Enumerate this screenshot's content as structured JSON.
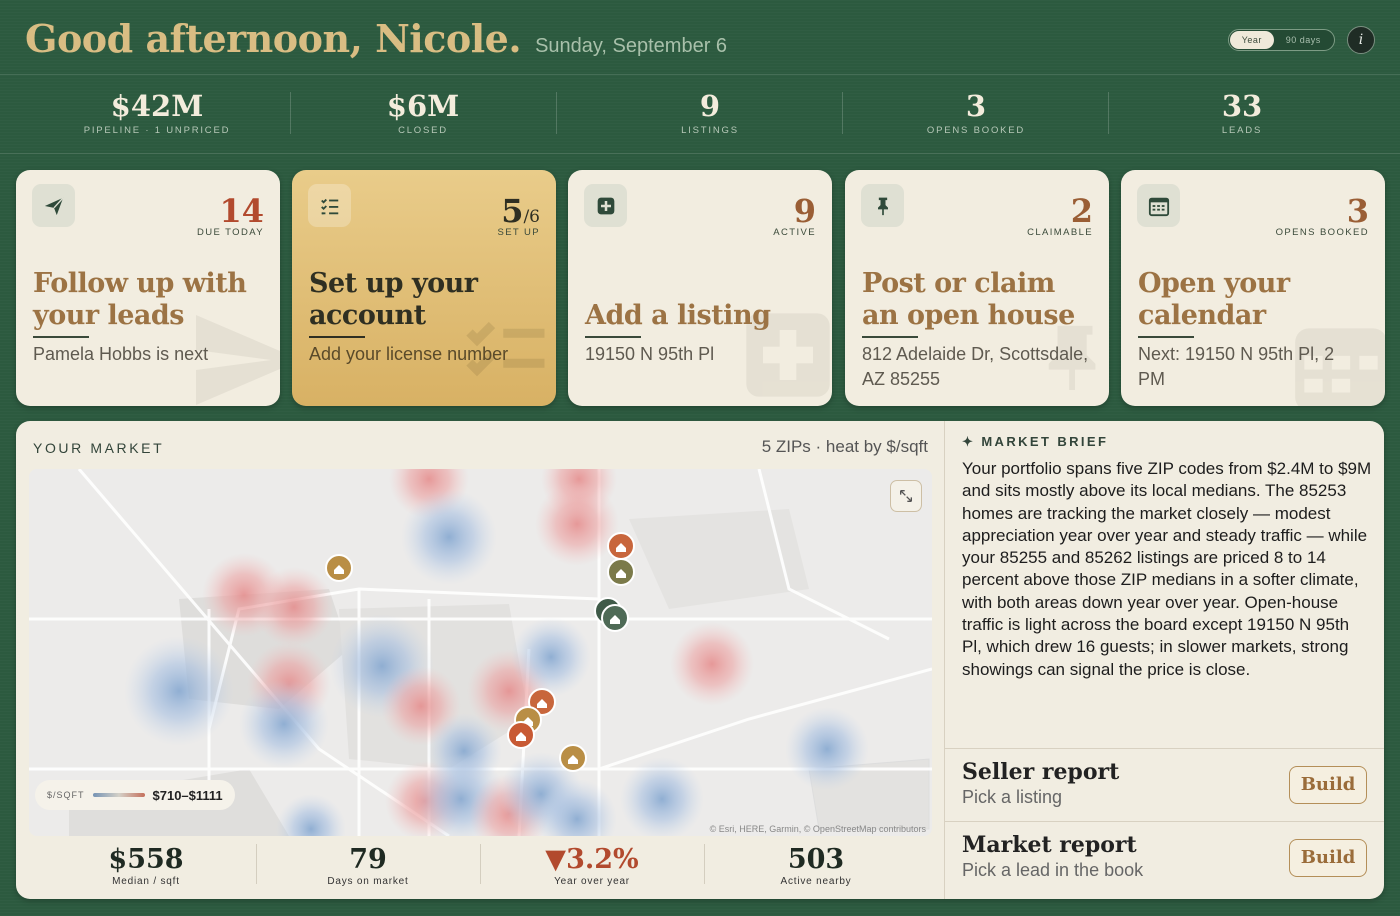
{
  "header": {
    "greeting": "Good afternoon, Nicole.",
    "date": "Sunday, September 6",
    "range_toggle": {
      "options": [
        "Year",
        "90 days"
      ],
      "selected": "Year"
    },
    "info_label": "i"
  },
  "stats": [
    {
      "value": "$42M",
      "label": "PIPELINE · 1 UNPRICED"
    },
    {
      "value": "$6M",
      "label": "CLOSED"
    },
    {
      "value": "9",
      "label": "LISTINGS"
    },
    {
      "value": "3",
      "label": "OPENS BOOKED"
    },
    {
      "value": "33",
      "label": "LEADS"
    }
  ],
  "cards": [
    {
      "icon": "paper-plane-icon",
      "number": "14",
      "caption": "DUE TODAY",
      "title": "Follow up with your leads",
      "subtitle": "Pamela Hobbs is next"
    },
    {
      "icon": "checklist-icon",
      "number": "5",
      "number_suffix": "/6",
      "caption": "SET UP",
      "title": "Set up your account",
      "subtitle": "Add your license number"
    },
    {
      "icon": "plus-square-icon",
      "number": "9",
      "caption": "ACTIVE",
      "title": "Add a listing",
      "subtitle": "19150 N 95th Pl"
    },
    {
      "icon": "pushpin-icon",
      "number": "2",
      "caption": "CLAIMABLE",
      "title": "Post or claim an open house",
      "subtitle": "812 Adelaide Dr, Scottsdale, AZ 85255"
    },
    {
      "icon": "calendar-icon",
      "number": "3",
      "caption": "OPENS BOOKED",
      "title": "Open your calendar",
      "subtitle": "Next: 19150 N 95th Pl, 2 PM"
    }
  ],
  "market": {
    "title": "YOUR MARKET",
    "note": "5 ZIPs · heat by $/sqft",
    "legend": {
      "label": "$/SQFT",
      "range": "$710–$1111"
    },
    "attribution": "© Esri, HERE, Garmin, © OpenStreetMap contributors",
    "stats": [
      {
        "value": "$558",
        "label": "Median / sqft"
      },
      {
        "value": "79",
        "label": "Days on market"
      },
      {
        "value": "3.2%",
        "label": "Year over year",
        "trend": "down"
      },
      {
        "value": "503",
        "label": "Active nearby"
      }
    ],
    "brief_title": "MARKET BRIEF",
    "brief": "Your portfolio spans five ZIP codes from $2.4M to $9M and sits mostly above its local medians. The 85253 homes are tracking the market closely — modest appreciation year over year and steady traffic — while your 85255 and 85262 listings are priced 8 to 14 percent above those ZIP medians in a softer climate, with both areas down year over year. Open-house traffic is light across the board except 19150 N 95th Pl, which drew 16 guests; in slower markets, strong showings can signal the price is close.",
    "reports": [
      {
        "title": "Seller report",
        "subtitle": "Pick a listing",
        "button": "Build"
      },
      {
        "title": "Market report",
        "subtitle": "Pick a lead in the book",
        "button": "Build"
      }
    ]
  },
  "colors": {
    "background": "#2c5a3f",
    "gold_accent": "#d9bd83",
    "card_bg": "#f2ede0",
    "heat_high": "#e48a8a",
    "heat_low": "#7fa3cc",
    "pin_orange": "#c8663c",
    "pin_olive": "#7b7a4a",
    "pin_green": "#3f5a48"
  }
}
